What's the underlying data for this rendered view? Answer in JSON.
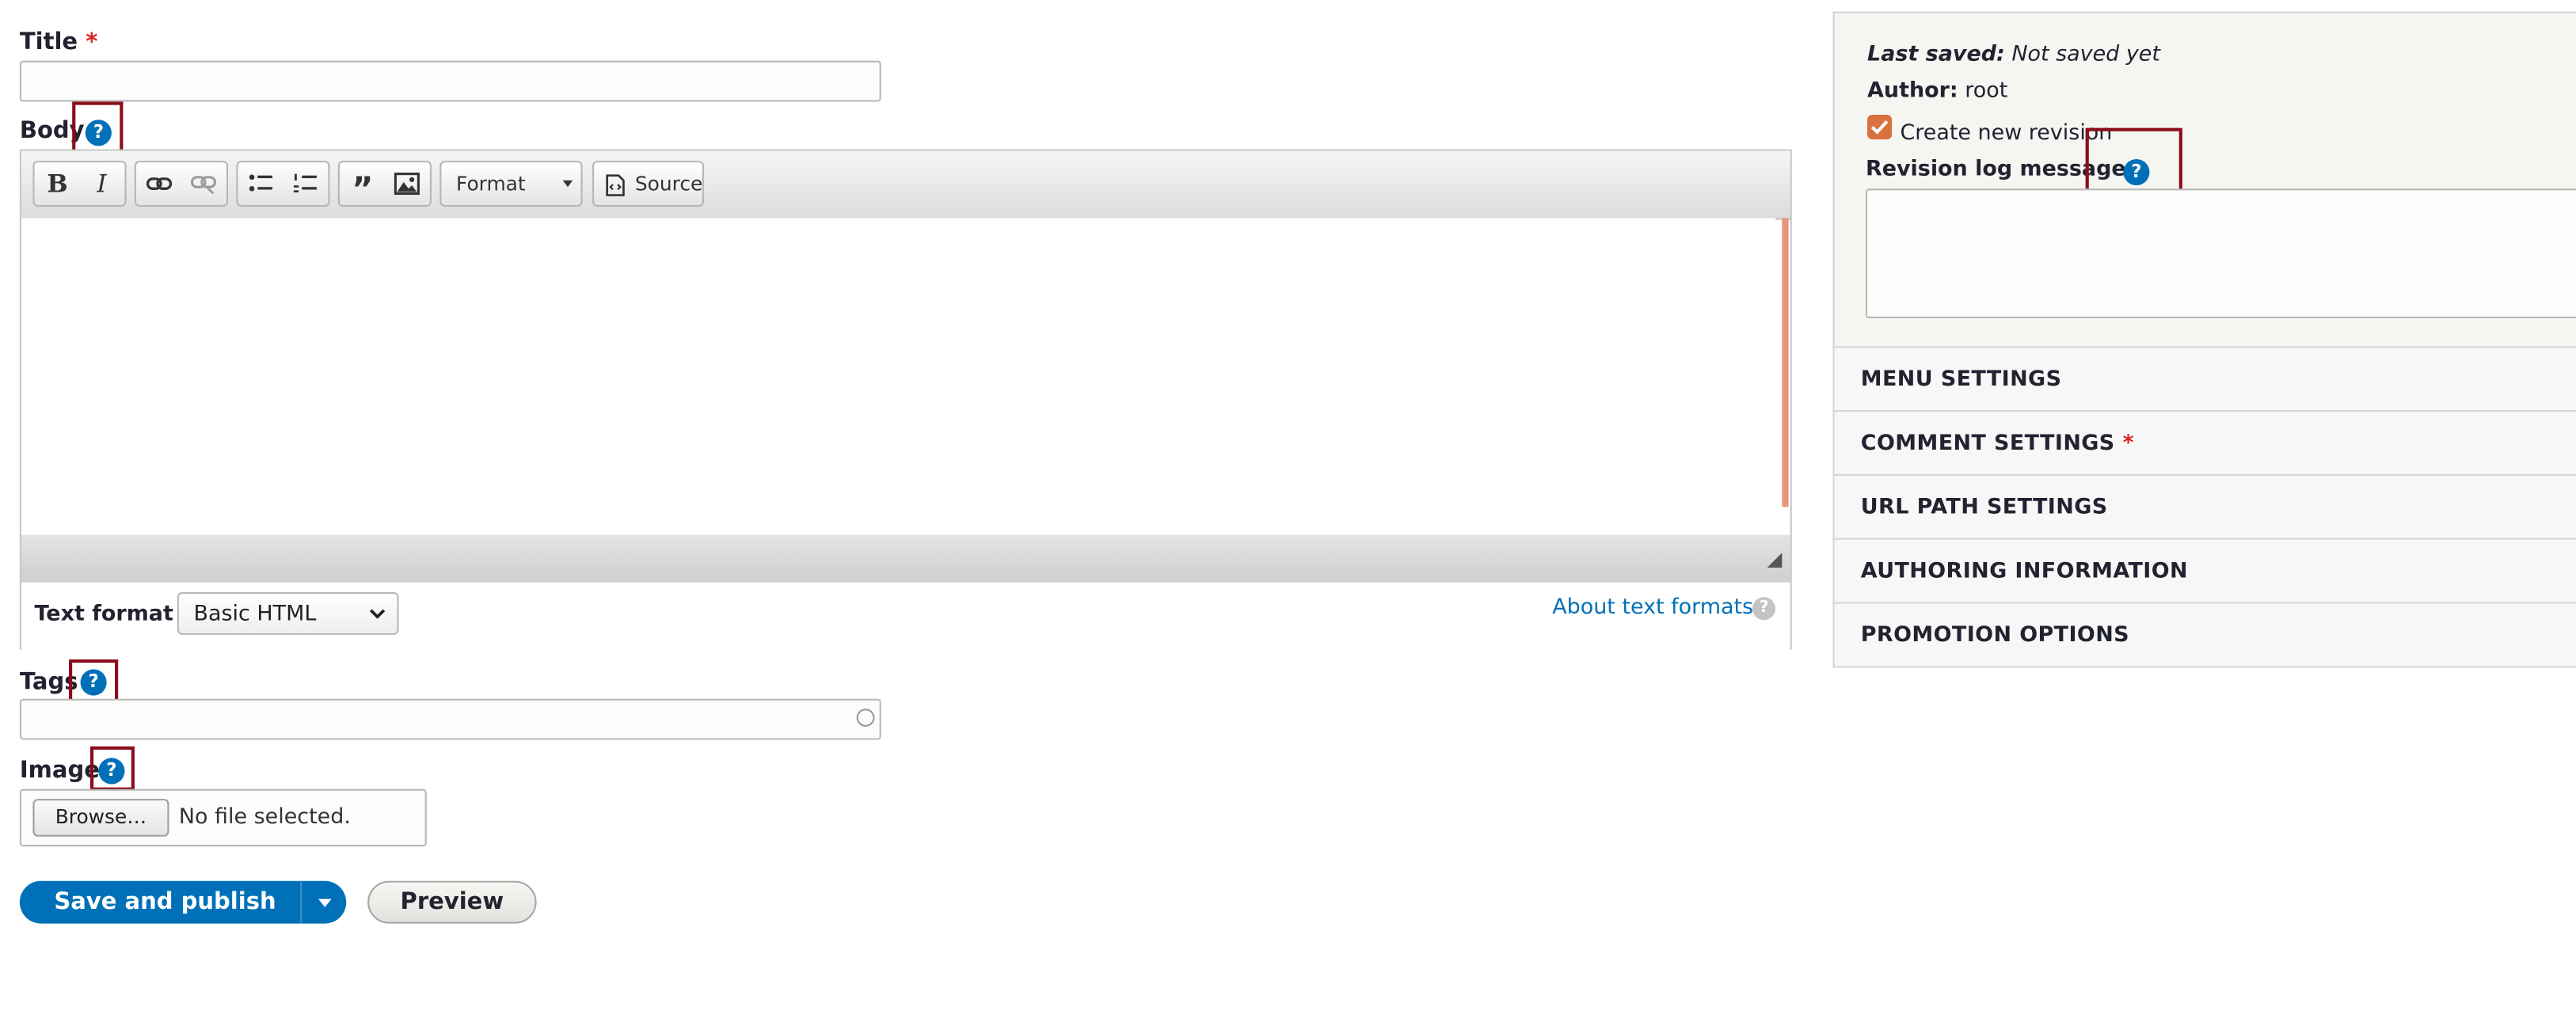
{
  "form": {
    "title_label": "Title",
    "required_mark": "*",
    "title_value": "",
    "body_label": "Body",
    "help_glyph": "?",
    "toolbar": {
      "format_label": "Format",
      "source_label": "Source",
      "bold_glyph": "B",
      "italic_glyph": "I",
      "blockquote_glyph": "”"
    },
    "text_format_label": "Text format",
    "text_format_value": "Basic HTML",
    "about_formats_link": "About text formats",
    "tags_label": "Tags",
    "tags_value": "",
    "image_label": "Image",
    "browse_button": "Browse…",
    "no_file_text": "No file selected.",
    "save_button": "Save and publish",
    "preview_button": "Preview"
  },
  "sidebar": {
    "last_saved_label": "Last saved:",
    "last_saved_value": "Not saved yet",
    "author_label": "Author:",
    "author_value": "root",
    "create_revision_label": "Create new revision",
    "create_revision_checked": true,
    "revision_log_label": "Revision log message",
    "revision_log_value": "",
    "sections": [
      {
        "label": "MENU SETTINGS"
      },
      {
        "label": "COMMENT SETTINGS",
        "required": "*"
      },
      {
        "label": "URL PATH SETTINGS"
      },
      {
        "label": "AUTHORING INFORMATION"
      },
      {
        "label": "PROMOTION OPTIONS"
      }
    ]
  },
  "colors": {
    "primary_blue": "#0071b8",
    "required_red": "#dc2323",
    "highlight_box": "#8b0d1a",
    "checkbox_orange": "#d9713e"
  }
}
